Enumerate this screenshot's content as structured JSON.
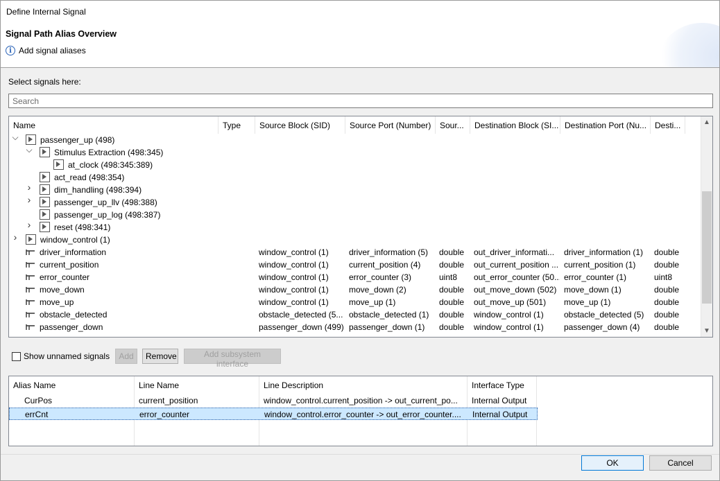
{
  "window": {
    "title": "Define Internal Signal"
  },
  "header": {
    "title": "Signal Path Alias Overview",
    "info": "Add signal aliases",
    "info_icon": "info-icon"
  },
  "select": {
    "label": "Select signals here:",
    "search_placeholder": "Search",
    "search_value": ""
  },
  "tree": {
    "columns": [
      "Name",
      "Type",
      "Source Block (SID)",
      "Source Port (Number)",
      "Sour...",
      "Destination Block (SI...",
      "Destination Port (Nu...",
      "Desti..."
    ],
    "rows": [
      {
        "name": "passenger_up (498)",
        "kind": "block",
        "twisty": "open",
        "cells": [
          "",
          "",
          "",
          "",
          "",
          "",
          ""
        ]
      },
      {
        "name": "Stimulus Extraction (498:345)",
        "kind": "block",
        "twisty": "open",
        "cells": [
          "",
          "",
          "",
          "",
          "",
          "",
          ""
        ]
      },
      {
        "name": "at_clock (498:345:389)",
        "kind": "block",
        "twisty": "none",
        "cells": [
          "",
          "",
          "",
          "",
          "",
          "",
          ""
        ]
      },
      {
        "name": "act_read (498:354)",
        "kind": "block",
        "twisty": "none",
        "cells": [
          "",
          "",
          "",
          "",
          "",
          "",
          ""
        ]
      },
      {
        "name": "dim_handling (498:394)",
        "kind": "block",
        "twisty": "closed",
        "cells": [
          "",
          "",
          "",
          "",
          "",
          "",
          ""
        ]
      },
      {
        "name": "passenger_up_llv (498:388)",
        "kind": "block",
        "twisty": "closed",
        "cells": [
          "",
          "",
          "",
          "",
          "",
          "",
          ""
        ]
      },
      {
        "name": "passenger_up_log (498:387)",
        "kind": "block",
        "twisty": "none",
        "cells": [
          "",
          "",
          "",
          "",
          "",
          "",
          ""
        ]
      },
      {
        "name": "reset (498:341)",
        "kind": "block",
        "twisty": "closed",
        "cells": [
          "",
          "",
          "",
          "",
          "",
          "",
          ""
        ]
      },
      {
        "name": "window_control (1)",
        "kind": "block",
        "twisty": "closed",
        "cells": [
          "",
          "",
          "",
          "",
          "",
          "",
          ""
        ]
      },
      {
        "name": "driver_information",
        "kind": "signal",
        "twisty": "none",
        "cells": [
          "",
          "window_control (1)",
          "driver_information (5)",
          "double",
          "out_driver_informati...",
          "driver_information (1)",
          "double"
        ]
      },
      {
        "name": "current_position",
        "kind": "signal",
        "twisty": "none",
        "cells": [
          "",
          "window_control (1)",
          "current_position (4)",
          "double",
          "out_current_position ...",
          "current_position (1)",
          "double"
        ]
      },
      {
        "name": "error_counter",
        "kind": "signal",
        "twisty": "none",
        "cells": [
          "",
          "window_control (1)",
          "error_counter (3)",
          "uint8",
          "out_error_counter (50...",
          "error_counter (1)",
          "uint8"
        ]
      },
      {
        "name": "move_down",
        "kind": "signal",
        "twisty": "none",
        "cells": [
          "",
          "window_control (1)",
          "move_down (2)",
          "double",
          "out_move_down (502)",
          "move_down (1)",
          "double"
        ]
      },
      {
        "name": "move_up",
        "kind": "signal",
        "twisty": "none",
        "cells": [
          "",
          "window_control (1)",
          "move_up (1)",
          "double",
          "out_move_up (501)",
          "move_up (1)",
          "double"
        ]
      },
      {
        "name": "obstacle_detected",
        "kind": "signal",
        "twisty": "none",
        "cells": [
          "",
          "obstacle_detected (5...",
          "obstacle_detected (1)",
          "double",
          "window_control (1)",
          "obstacle_detected (5)",
          "double"
        ]
      },
      {
        "name": "passenger_down",
        "kind": "signal",
        "twisty": "none",
        "cells": [
          "",
          "passenger_down (499)",
          "passenger_down (1)",
          "double",
          "window_control (1)",
          "passenger_down (4)",
          "double"
        ]
      }
    ]
  },
  "options": {
    "show_unnamed_label": "Show unnamed signals",
    "add_label": "Add",
    "remove_label": "Remove",
    "add_subsystem_label": "Add subsystem interface"
  },
  "aliases": {
    "columns": [
      "Alias Name",
      "Line Name",
      "Line Description",
      "Interface Type"
    ],
    "rows": [
      {
        "alias": "CurPos",
        "line": "current_position",
        "desc": "window_control.current_position -> out_current_po...",
        "iface": "Internal Output"
      },
      {
        "alias": "errCnt",
        "line": "error_counter",
        "desc": "window_control.error_counter -> out_error_counter....",
        "iface": "Internal Output"
      }
    ]
  },
  "footer": {
    "ok_label": "OK",
    "cancel_label": "Cancel"
  },
  "colors": {
    "selection": "#cce8ff",
    "default_button_border": "#0078d7",
    "info_icon": "#2a63b8"
  }
}
